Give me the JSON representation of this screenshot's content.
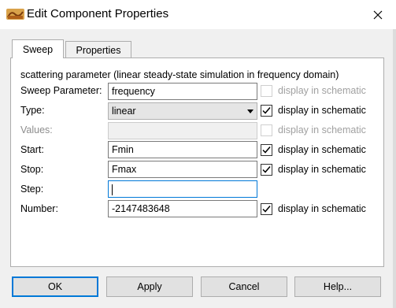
{
  "window": {
    "title": "Edit Component Properties",
    "app_icon": "qucs-app-icon",
    "close_icon": "close-icon"
  },
  "tabs": [
    {
      "label": "Sweep",
      "active": true
    },
    {
      "label": "Properties",
      "active": false
    }
  ],
  "sweep": {
    "header": "scattering parameter (linear steady-state simulation in frequency domain)",
    "display_label": "display in schematic",
    "rows": {
      "sweep_parameter": {
        "label": "Sweep Parameter:",
        "value": "frequency",
        "display_checked": false,
        "enabled": false
      },
      "type": {
        "label": "Type:",
        "value": "linear",
        "display_checked": true,
        "enabled": true
      },
      "values": {
        "label": "Values:",
        "value": "",
        "display_checked": false,
        "enabled": false
      },
      "start": {
        "label": "Start:",
        "value": "Fmin",
        "display_checked": true,
        "enabled": true
      },
      "stop": {
        "label": "Stop:",
        "value": "Fmax",
        "display_checked": true,
        "enabled": true
      },
      "step": {
        "label": "Step:",
        "value": ""
      },
      "number": {
        "label": "Number:",
        "value": "-2147483648",
        "display_checked": true,
        "enabled": true
      }
    }
  },
  "buttons": {
    "ok": "OK",
    "apply": "Apply",
    "cancel": "Cancel",
    "help": "Help..."
  },
  "colors": {
    "focus": "#0078d7",
    "panel": "#ffffff",
    "window": "#f0f0f0"
  }
}
